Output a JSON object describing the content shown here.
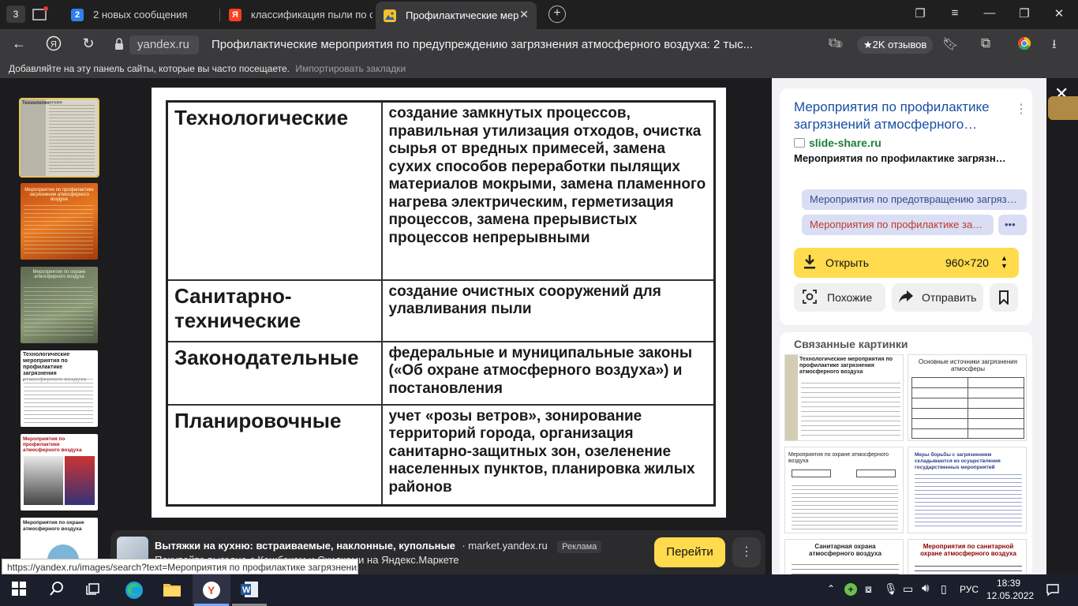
{
  "tabs": {
    "group_count": "3",
    "items": [
      {
        "label": "2 новых сообщения",
        "icon_text": "2"
      },
      {
        "label": "классификация пыли по с",
        "icon_text": "Я"
      },
      {
        "label": "Профилактические мер",
        "icon_text": ""
      }
    ]
  },
  "address": {
    "domain": "yandex.ru",
    "title": "Профилактические мероприятия по предупреждению загрязнения атмосферного воздуха: 2 тыс...",
    "reviews": "2K отзывов",
    "ext_badge": "1"
  },
  "bookmarks": {
    "hint": "Добавляйте на эту панель сайты, которые вы часто посещаете.",
    "import": "Импортировать закладки"
  },
  "slide": {
    "rows": [
      {
        "category": "Технологические",
        "desc": "создание замкнутых процессов, правильная утилизация отходов, очистка сырья от вредных примесей, замена сухих способов переработки пылящих материалов мокрыми, замена пламенного нагрева электрическим, герметизация процессов, замена прерывистых процессов непрерывными"
      },
      {
        "category": "Санитарно-технические",
        "desc": "создание очистных сооружений для улавливания пыли"
      },
      {
        "category": "Законодательные",
        "desc": "федеральные и муниципальные законы («Об охране атмосферного воздуха») и  постановления"
      },
      {
        "category": "Планировочные",
        "desc": "учет «розы ветров», зонирование территорий города, организация санитарно-защитных зон, озеленение населенных пунктов, планировка жилых районов"
      }
    ]
  },
  "panel": {
    "source_title": "Мероприятия по профилактике загрязнений атмосферного…",
    "source_domain": "slide-share.ru",
    "source_desc": "Мероприятия по профилактике загрязн…",
    "chip1": "Мероприятия по предотвращению загряз…",
    "chip2": "Мероприятия по профилактике за…",
    "more": "•••",
    "open_label": "Открыть",
    "size": "960×720",
    "similar_label": "Похожие",
    "share_label": "Отправить",
    "related_heading": "Связанные картинки",
    "related": [
      {
        "title": "Технологические мероприятия по профилактике загрязнения атмосферного воздуха"
      },
      {
        "title": "Основные источники загрязнения атмосферы"
      },
      {
        "title": "Мероприятия по охране атмосферного воздуха"
      },
      {
        "title": "Меры борьбы с загрязнением складываются из осуществления государственных мероприятий"
      },
      {
        "title": "Санитарная охрана атмосферного воздуха"
      },
      {
        "title": "Мероприятия по санитарной охране атмосферного воздуха"
      }
    ]
  },
  "thumbs": [
    {
      "title": "Технологические"
    },
    {
      "title": "Мероприятия по профилактике загрязнения атмосферного воздуха"
    },
    {
      "title": "Мероприятия по охране атмосферного воздуха"
    },
    {
      "title": "Технологические мероприятия по профилактике загрязнения атмосферного воздуха"
    },
    {
      "title": "Мероприятия по профилактике атмосферного воздуха"
    },
    {
      "title": "Мероприятия по охране атмосферного воздуха"
    }
  ],
  "ad": {
    "title": "Вытяжки на кухню: встраиваемые, наклонные, купольные",
    "source": "· market.yandex.ru",
    "badge": "Реклама",
    "subtitle": "Покупайте выгодно с Кешбэком и Скидками на Яндекс.Маркете",
    "button": "Перейти"
  },
  "status_url": "https://yandex.ru/images/search?text=Мероприятия по профилактике загрязнения",
  "taskbar": {
    "lang": "РУС",
    "time": "18:39",
    "date": "12.05.2022"
  },
  "colors": {
    "accent_yellow": "#ffdb4d",
    "link_blue": "#1a4fa3",
    "domain_green": "#1a7f37"
  }
}
